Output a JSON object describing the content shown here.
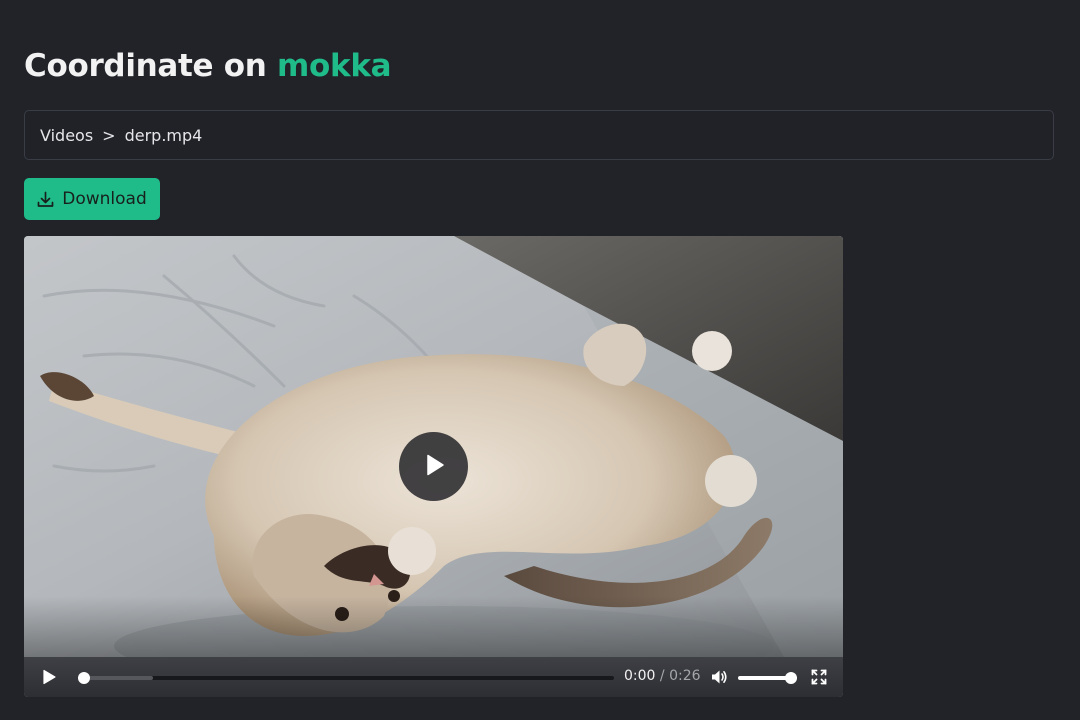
{
  "header": {
    "title_prefix": "Coordinate on",
    "title_brand": "mokka",
    "brand_color": "#1fbc8a"
  },
  "breadcrumb": {
    "items": [
      "Videos",
      "derp.mp4"
    ],
    "separator": ">"
  },
  "actions": {
    "download_label": "Download",
    "download_icon": "download-icon"
  },
  "player": {
    "current_time": "0:00",
    "duration": "0:26",
    "time_separator": "/",
    "progress_fraction": 0.0,
    "buffered_fraction": 0.14,
    "volume_fraction": 1.0,
    "is_playing": false,
    "icons": [
      "play-icon",
      "volume-icon",
      "fullscreen-icon"
    ]
  }
}
